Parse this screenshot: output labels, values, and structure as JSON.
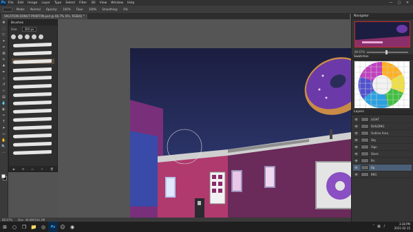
{
  "app": {
    "logo": "Ps",
    "menu": [
      "File",
      "Edit",
      "Image",
      "Layer",
      "Type",
      "Select",
      "Filter",
      "3D",
      "View",
      "Window",
      "Help"
    ],
    "window_controls": [
      "—",
      "▢",
      "✕"
    ]
  },
  "options_bar": {
    "items": [
      "Mode:",
      "Normal",
      "Opacity:",
      "100%",
      "Flow:",
      "100%",
      "Smoothing:",
      "0%"
    ]
  },
  "document": {
    "tab_title": "VACATION DONUT PRINTFIN.psd @ 66.7% (Pic, RGB/8) *"
  },
  "brushes_panel": {
    "title": "Brushes",
    "size_label": "Size:",
    "size_value": "304 px",
    "stroke_count": 14
  },
  "status_bar": {
    "zoom": "66.67%",
    "doc_size": "Doc: 46.8M/164.2M"
  },
  "right_panels": {
    "navigator_title": "Navigator",
    "navigator_zoom": "66.67%",
    "swatches_title": "Swatches",
    "layers_title": "Layers",
    "layers": [
      {
        "name": "LIGHT",
        "selected": false
      },
      {
        "name": "BUILDING",
        "selected": false
      },
      {
        "name": "Outline Area",
        "selected": false
      },
      {
        "name": "Sky",
        "selected": false
      },
      {
        "name": "Sign",
        "selected": false
      },
      {
        "name": "Store",
        "selected": false
      },
      {
        "name": "Pic",
        "selected": false
      },
      {
        "name": "Bg",
        "selected": true
      },
      {
        "name": "BKG",
        "selected": false
      }
    ]
  },
  "taskbar": {
    "icons": [
      "windows-icon",
      "search-icon",
      "task-view-icon",
      "file-explorer-icon",
      "chrome-icon",
      "photoshop-icon",
      "discord-icon",
      "steam-icon"
    ],
    "time": "3:28 PM",
    "date": "2021-02-15"
  },
  "colors": {
    "accent": "#31a8ff",
    "sky": "#1d2147",
    "building": "#b03a6e",
    "donut": "#6b3aa8"
  }
}
